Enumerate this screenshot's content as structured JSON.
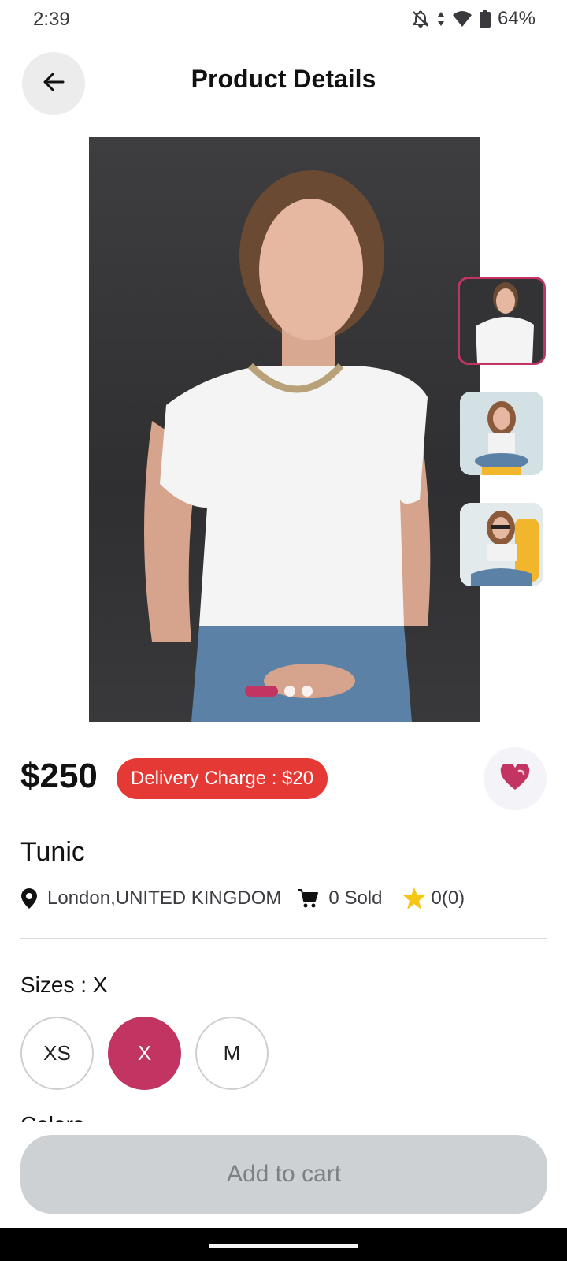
{
  "status_bar": {
    "time": "2:39",
    "battery": "64%",
    "icons": [
      "notifications-off-icon",
      "data-arrows-icon",
      "wifi-icon",
      "battery-icon"
    ]
  },
  "header": {
    "title": "Product Details",
    "back_icon": "arrow-left-icon"
  },
  "gallery": {
    "dots_total": 3,
    "active_dot": 0,
    "thumbnails": [
      "thumbnail-1",
      "thumbnail-2",
      "thumbnail-3"
    ],
    "selected_thumbnail": 0
  },
  "product": {
    "price": "$250",
    "delivery_charge": "Delivery Charge : $20",
    "name": "Tunic",
    "location": "London,UNITED KINGDOM",
    "sold": "0 Sold",
    "rating": "0(0)",
    "favorite": true
  },
  "sizes": {
    "label": "Sizes : X",
    "options": [
      "XS",
      "X",
      "M"
    ],
    "selected": "X"
  },
  "colors": {
    "label": "Colors"
  },
  "actions": {
    "add_to_cart": "Add to cart"
  },
  "colors_palette": {
    "accent": "#c23461",
    "delivery_badge": "#e53935",
    "rating_star": "#f5c518",
    "button_disabled": "#ced1d4"
  }
}
